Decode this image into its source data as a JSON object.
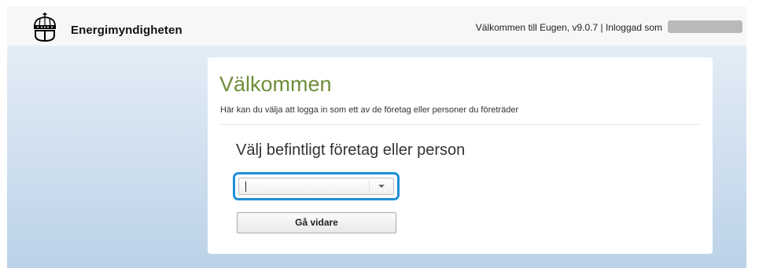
{
  "header": {
    "brand": "Energimyndigheten",
    "logo_icon": "crown-shield-icon",
    "welcome_text": "Välkommen till Eugen, v9.0.7 | Inloggad som"
  },
  "card": {
    "title": "Välkommen",
    "subtitle": "Här kan du välja att logga in som ett av de företag eller personer du företräder",
    "select_heading": "Välj befintligt företag eller person",
    "select_value": "",
    "dropdown_icon": "chevron-down-icon",
    "continue_label": "Gå vidare"
  },
  "colors": {
    "title_green": "#6f8e3a",
    "focus_blue": "#1f8fd6",
    "background_blue": "#bcd2e8"
  }
}
